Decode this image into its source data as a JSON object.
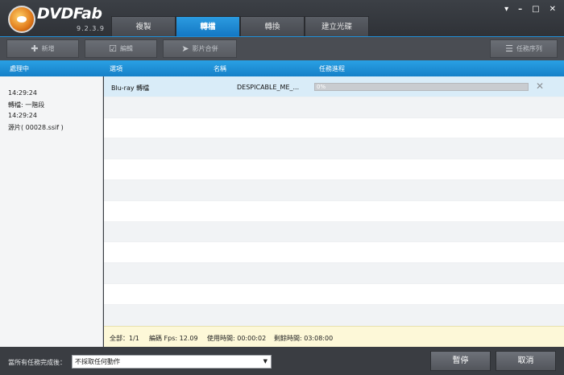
{
  "app": {
    "brand": "DVDFab",
    "version": "9.2.3.9"
  },
  "tabs": [
    {
      "label": "複製"
    },
    {
      "label": "轉檔"
    },
    {
      "label": "轉換"
    },
    {
      "label": "建立光碟"
    }
  ],
  "window": {
    "minimize": "▾",
    "restore": "–",
    "maximize": "□",
    "close": "✕"
  },
  "toolbar": {
    "add": "新增",
    "edit": "編輯",
    "merge": "影片合併",
    "tasklist": "任務序列"
  },
  "header": {
    "processing": "處理中",
    "col_option": "選項",
    "col_name": "名稱",
    "col_progress": "任務進程"
  },
  "log": {
    "time1": "14:29:24",
    "line1": "轉檔: 一階段",
    "time2": "14:29:24",
    "line2": "源片( 00028.ssif )"
  },
  "task": {
    "option": "Blu-ray 轉檔",
    "name": "DESPICABLE_ME_...",
    "progress_text": "0%",
    "progress_value": 0
  },
  "status": {
    "total": "全部：1/1",
    "fps": "編碼 Fps: 12.09",
    "elapsed": "使用時間:   00:00:02",
    "remaining": "剩餘時間:   03:08:00"
  },
  "bottom": {
    "label": "當所有任務完成後：",
    "select_value": "不採取任何動作",
    "pause": "暫停",
    "cancel": "取消"
  },
  "colors": {
    "accent": "#1a8ad6",
    "status_bg": "#fdf8d8"
  }
}
